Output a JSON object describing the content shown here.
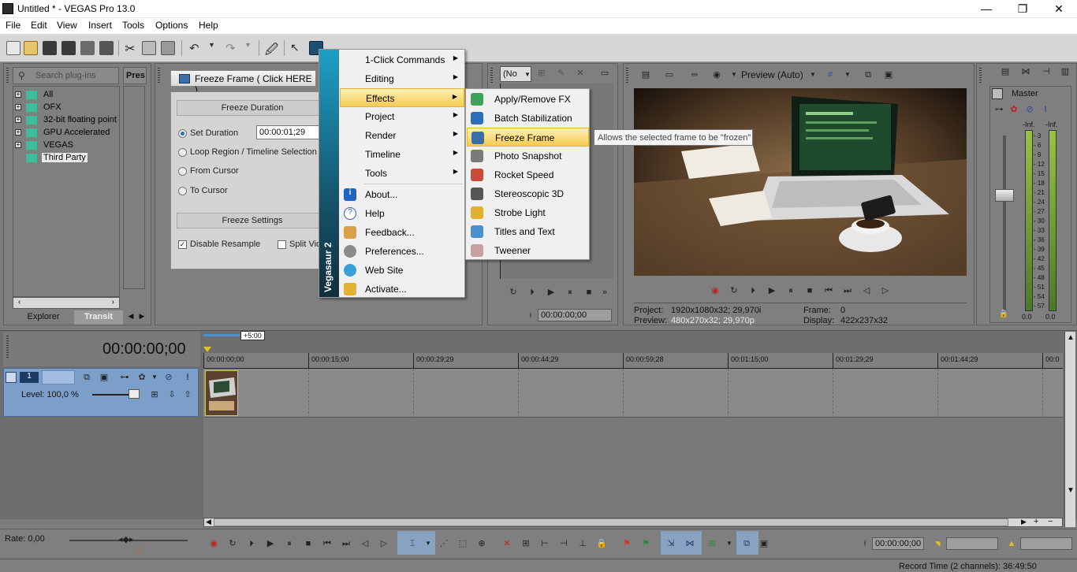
{
  "window": {
    "title": "Untitled * - VEGAS Pro 13.0",
    "minimize": "—",
    "maximize": "❐",
    "close": "✕"
  },
  "menu": [
    "File",
    "Edit",
    "View",
    "Insert",
    "Tools",
    "Options",
    "Help"
  ],
  "plugins": {
    "search_placeholder": "Search plug-ins",
    "presets_label": "Pres",
    "tree": [
      "All",
      "OFX",
      "32-bit floating point",
      "GPU Accelerated",
      "VEGAS",
      "Third Party"
    ],
    "tabs": [
      "Explorer",
      "Transit"
    ]
  },
  "fx": {
    "title": "Freeze Frame ( Click HERE )",
    "section1": "Freeze Duration",
    "set_duration": "Set Duration",
    "duration_value": "00:00:01;29",
    "loop_region": "Loop Region / Timeline Selection",
    "from_cursor": "From Cursor",
    "to_cursor": "To Cursor",
    "section2": "Freeze Settings",
    "disable_resample": "Disable Resample",
    "split_video": "Split Vid"
  },
  "vegasaur": {
    "brand": "Vegasaur 2",
    "items": [
      {
        "label": "1-Click Commands",
        "sub": true
      },
      {
        "label": "Editing",
        "sub": true
      },
      {
        "label": "Effects",
        "sub": true
      },
      {
        "label": "Project",
        "sub": true
      },
      {
        "label": "Render",
        "sub": true
      },
      {
        "label": "Timeline",
        "sub": true
      },
      {
        "label": "Tools",
        "sub": true
      }
    ],
    "items2": [
      "About...",
      "Help",
      "Feedback...",
      "Preferences...",
      "Web Site",
      "Activate..."
    ],
    "effects": [
      "Apply/Remove FX",
      "Batch Stabilization",
      "Freeze Frame",
      "Photo Snapshot",
      "Rocket Speed",
      "Stereoscopic 3D",
      "Strobe Light",
      "Titles and Text",
      "Tweener"
    ],
    "tooltip": "Allows the selected frame to be \"frozen\""
  },
  "trimmer": {
    "combo": "(No",
    "timecode": "00:00:00;00"
  },
  "preview": {
    "label": "Preview (Auto)",
    "project_label": "Project:",
    "project_value": "1920x1080x32; 29,970i",
    "preview_label": "Preview:",
    "preview_value": "480x270x32; 29,970p",
    "frame_label": "Frame:",
    "frame_value": "0",
    "display_label": "Display:",
    "display_value": "422x237x32"
  },
  "master": {
    "label": "Master",
    "inf_left": "-Inf.",
    "inf_right": "-Inf.",
    "scale": [
      "3",
      "6",
      "9",
      "12",
      "15",
      "18",
      "21",
      "24",
      "27",
      "30",
      "33",
      "36",
      "39",
      "42",
      "45",
      "48",
      "51",
      "54",
      "57"
    ],
    "bottom_left": "0.0",
    "bottom_right": "0.0"
  },
  "timeline": {
    "timecode": "00:00:00;00",
    "marker": "+5:00",
    "track_number": "1",
    "level": "Level: 100,0 %",
    "ruler": [
      "00:00:00;00",
      "00:00:15;00",
      "00:00:29;29",
      "00:00:44;29",
      "00:00:59;28",
      "00:01:15;00",
      "00:01:29;29",
      "00:01:44;29",
      "00:0"
    ]
  },
  "transport": {
    "rate": "Rate: 0,00",
    "timecode": "00:00:00;00"
  },
  "status": {
    "record_time": "Record Time (2 channels): 36:49:50"
  }
}
